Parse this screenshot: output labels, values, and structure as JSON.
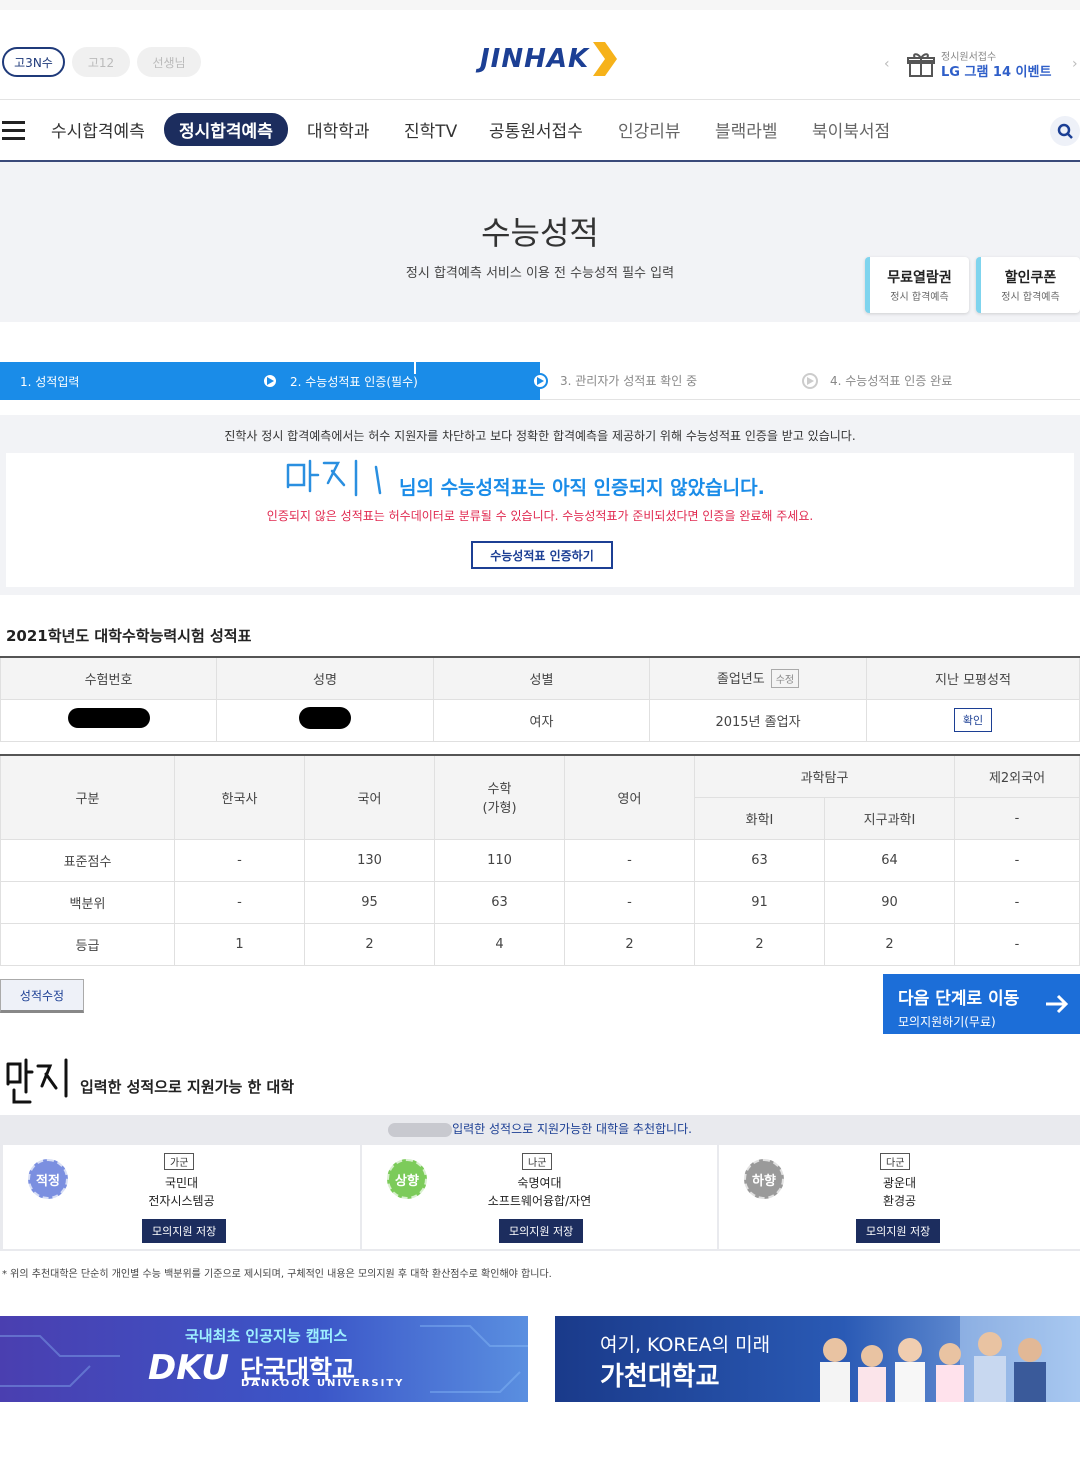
{
  "header": {
    "chips": [
      "고3N수",
      "고12",
      "선생님"
    ],
    "logo": "JINHAK",
    "promo_small": "정시원서접수",
    "promo_big": "LG 그램 14 이벤트"
  },
  "nav": {
    "items": [
      "수시합격예측",
      "정시합격예측",
      "대학학과",
      "진학TV",
      "공통원서접수",
      "인강리뷰",
      "블랙라벨",
      "북이북서점"
    ],
    "active": "정시합격예측"
  },
  "banner": {
    "title": "수능성적",
    "subtitle": "정시 합격예측 서비스 이용 전 수능성적 필수 입력",
    "coupons": [
      {
        "title": "무료열람권",
        "sub": "정시 합격예측"
      },
      {
        "title": "할인쿠폰",
        "sub": "정시 합격예측"
      }
    ]
  },
  "steps": [
    "1. 성적입력",
    "2. 수능성적표 인증(필수)",
    "3. 관리자가 성적표 확인 중",
    "4. 수능성적표 인증 완료"
  ],
  "cert": {
    "note": "진학사 정시 합격예측에서는 허수 지원자를 차단하고 보다 정확한 합격예측을 제공하기 위해 수능성적표 인증을 받고 있습니다.",
    "main": "님의 수능성적표는 아직 인증되지 않았습니다.",
    "warn": "인증되지 않은 성적표는 허수데이터로 분류될 수 있습니다. 수능성적표가 준비되셨다면 인증을 완료해 주세요.",
    "button": "수능성적표 인증하기"
  },
  "scorecard": {
    "title": "2021학년도 대학수학능력시험 성적표",
    "info_headers": [
      "수험번호",
      "성명",
      "성별",
      "졸업년도",
      "지난 모평성적"
    ],
    "edit_small": "수정",
    "gender": "여자",
    "grad_year": "2015년 졸업자",
    "confirm": "확인",
    "score_headers": {
      "category": "구분",
      "korean_history": "한국사",
      "korean": "국어",
      "math": "수학",
      "math_type": "(가형)",
      "english": "영어",
      "science": "과학탐구",
      "foreign": "제2외국어",
      "chem": "화학Ⅰ",
      "earth": "지구과학Ⅰ",
      "foreign_sub": "-"
    },
    "rows": [
      {
        "label": "표준점수",
        "values": [
          "-",
          "130",
          "110",
          "-",
          "63",
          "64",
          "-"
        ]
      },
      {
        "label": "백분위",
        "values": [
          "-",
          "95",
          "63",
          "-",
          "91",
          "90",
          "-"
        ]
      },
      {
        "label": "등급",
        "values": [
          "1",
          "2",
          "4",
          "2",
          "2",
          "2",
          "-"
        ]
      }
    ],
    "edit_button": "성적수정",
    "next_title": "다음 단계로 이동",
    "next_sub": "모의지원하기(무료)"
  },
  "recommend": {
    "title": "입력한 성적으로 지원가능 한 대학",
    "note": "입력한 성적으로 지원가능한 대학을 추천합니다.",
    "items": [
      {
        "badge": "적정",
        "color": "#7b8fe0",
        "gun": "가군",
        "univ": "국민대",
        "dept": "전자시스템공",
        "save": "모의지원 저장"
      },
      {
        "badge": "상향",
        "color": "#7ccb5a",
        "gun": "나군",
        "univ": "숙명여대",
        "dept": "소프트웨어융합/자연",
        "save": "모의지원 저장"
      },
      {
        "badge": "하향",
        "color": "#9a9a9a",
        "gun": "다군",
        "univ": "광운대",
        "dept": "환경공",
        "save": "모의지원 저장"
      }
    ],
    "footnote": "* 위의 추천대학은 단순히 개인별 수능 백분위를 기준으로 제시되며, 구체적인 내용은 모의지원 후 대학 환산점수로 확인해야 합니다."
  },
  "ads": {
    "ad1_top": "국내최초 인공지능 캠퍼스",
    "ad1_logo": "DKU",
    "ad1_name": "단국대학교",
    "ad1_eng": "DANKOOK UNIVERSITY",
    "ad2_line1": "여기, KOREA의 미래",
    "ad2_line2": "가천대학교"
  }
}
